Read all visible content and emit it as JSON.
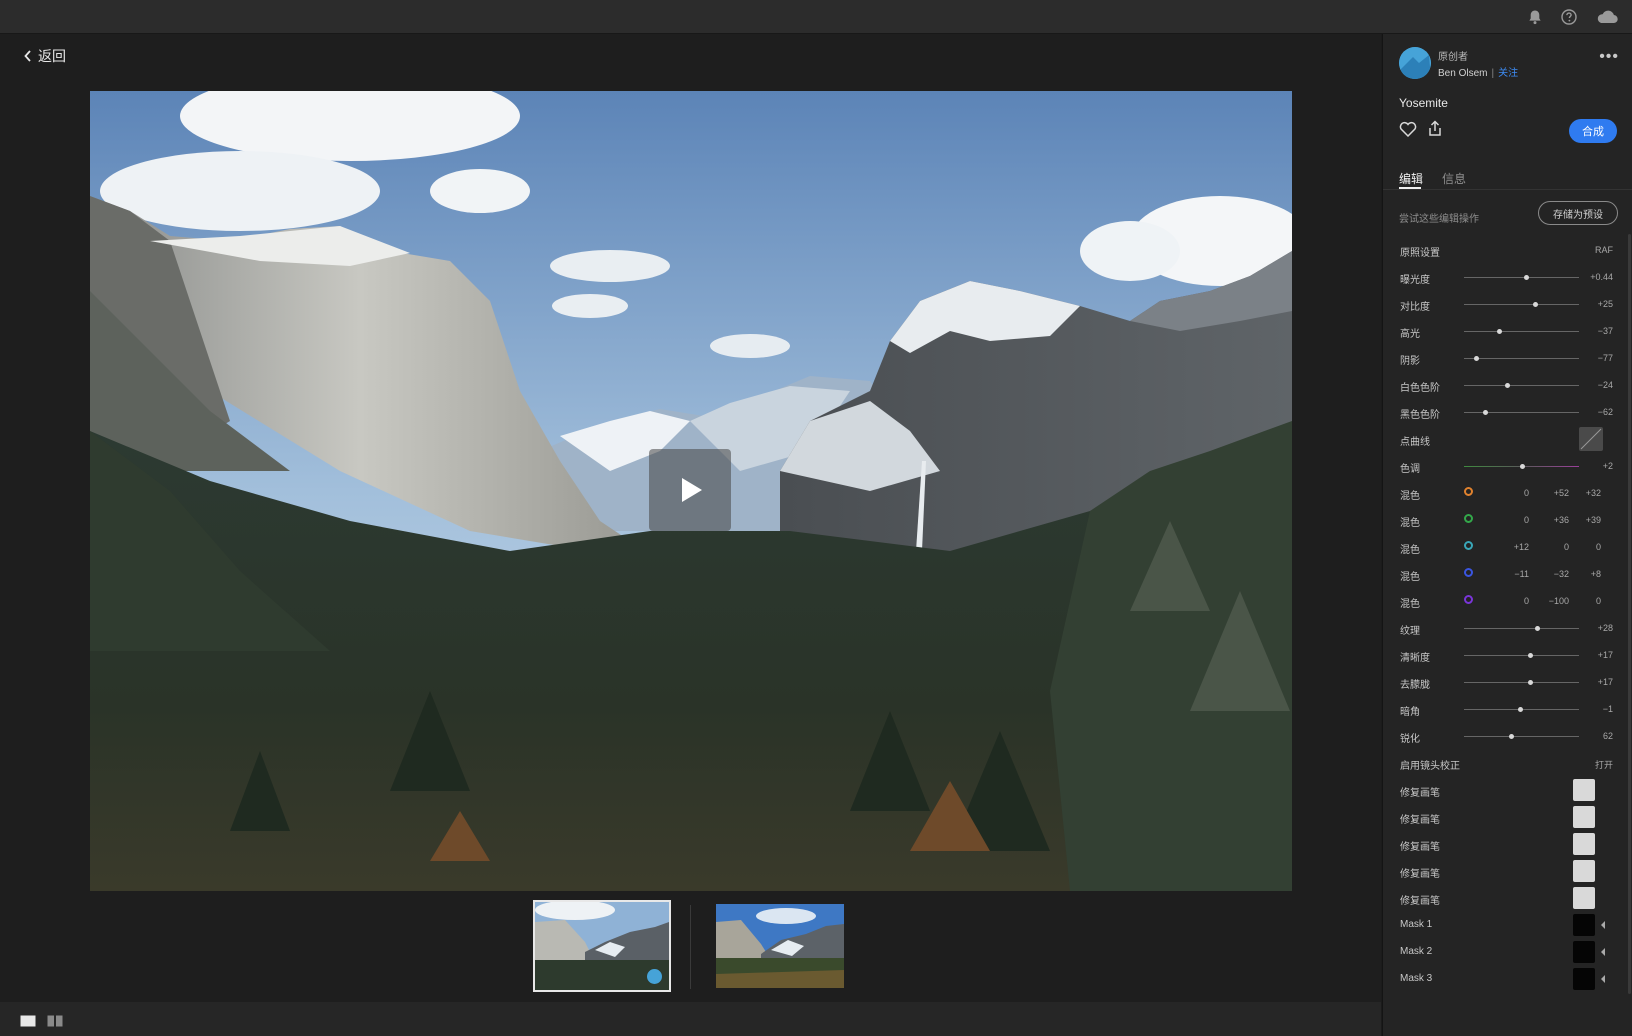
{
  "nav": {
    "back_label": "返回"
  },
  "panel": {
    "original_label": "原创者",
    "author_name": "Ben Olsem",
    "separator": "|",
    "follow_label": "关注",
    "more_label": "•••",
    "title": "Yosemite",
    "combine_label": "合成",
    "tabs": [
      {
        "label": "编辑"
      },
      {
        "label": "信息"
      }
    ],
    "try_label": "尝试这些编辑操作",
    "save_preset_label": "存储为预设",
    "profile": {
      "label": "原照设置",
      "value": "RAF"
    },
    "sliders": [
      {
        "label": "曝光度",
        "value": "+0.44",
        "level": 0.54
      },
      {
        "label": "对比度",
        "value": "+25",
        "level": 0.62
      },
      {
        "label": "高光",
        "value": "−37",
        "level": 0.31
      },
      {
        "label": "阴影",
        "value": "−77",
        "level": 0.11
      },
      {
        "label": "白色色阶",
        "value": "−24",
        "level": 0.38
      },
      {
        "label": "黑色色阶",
        "value": "−62",
        "level": 0.19
      }
    ],
    "curve": {
      "label": "点曲线"
    },
    "tint": {
      "label": "色调",
      "value": "+2",
      "level": 0.51
    },
    "mix": [
      {
        "label": "混色",
        "color": "#e0822e",
        "v1": "0",
        "v2": "+52",
        "v3": "+32"
      },
      {
        "label": "混色",
        "color": "#33a84a",
        "v1": "0",
        "v2": "+36",
        "v3": "+39"
      },
      {
        "label": "混色",
        "color": "#39a7b8",
        "v1": "+12",
        "v2": "0",
        "v3": "0"
      },
      {
        "label": "混色",
        "color": "#3a55e0",
        "v1": "−11",
        "v2": "−32",
        "v3": "+8"
      },
      {
        "label": "混色",
        "color": "#7a35d8",
        "v1": "0",
        "v2": "−100",
        "v3": "0"
      }
    ],
    "sliders2": [
      {
        "label": "纹理",
        "value": "+28",
        "level": 0.64
      },
      {
        "label": "清晰度",
        "value": "+17",
        "level": 0.58
      },
      {
        "label": "去朦胧",
        "value": "+17",
        "level": 0.58
      },
      {
        "label": "暗角",
        "value": "−1",
        "level": 0.49
      },
      {
        "label": "锐化",
        "value": "62",
        "level": 0.41
      }
    ],
    "lens": {
      "label": "启用镜头校正",
      "value": "打开"
    },
    "heal": [
      {
        "label": "修复画笔"
      },
      {
        "label": "修复画笔"
      },
      {
        "label": "修复画笔"
      },
      {
        "label": "修复画笔"
      },
      {
        "label": "修复画笔"
      }
    ],
    "masks": [
      {
        "label": "Mask 1"
      },
      {
        "label": "Mask 2"
      },
      {
        "label": "Mask 3"
      }
    ]
  },
  "colors": {
    "accent": "#2f7bf0",
    "link": "#3d8bf2"
  }
}
